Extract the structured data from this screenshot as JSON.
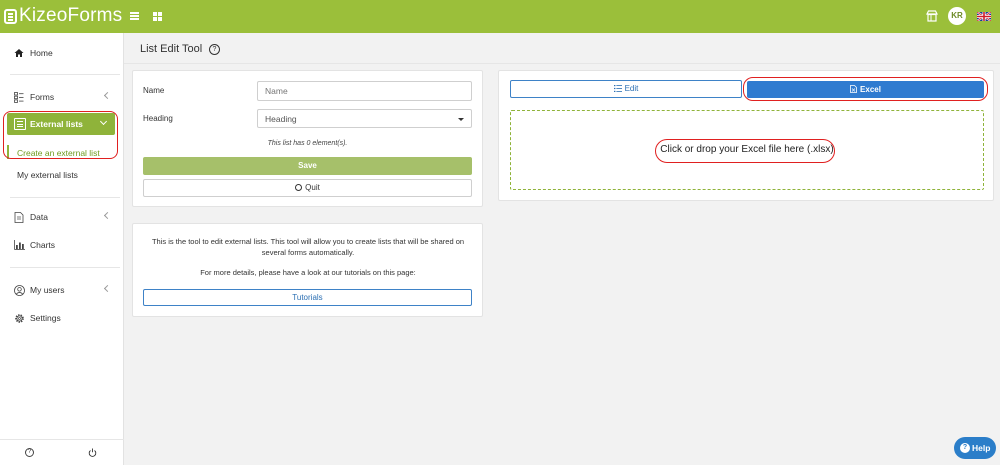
{
  "app": {
    "logo_text": "KizeoForms",
    "avatar_initials": "KR"
  },
  "sidebar": {
    "items": [
      {
        "label": "Home",
        "icon": "home-icon"
      },
      {
        "label": "Forms",
        "icon": "forms-icon"
      },
      {
        "label": "External lists",
        "icon": "list-icon"
      },
      {
        "label": "Data",
        "icon": "data-icon"
      },
      {
        "label": "Charts",
        "icon": "chart-icon"
      },
      {
        "label": "My users",
        "icon": "user-icon"
      },
      {
        "label": "Settings",
        "icon": "gear-icon"
      }
    ],
    "subitems": [
      {
        "label": "Create an external list"
      },
      {
        "label": "My external lists"
      }
    ],
    "footer": {
      "help_icon": "question-circle-icon",
      "power_icon": "power-icon"
    }
  },
  "page": {
    "title": "List Edit Tool"
  },
  "form": {
    "name_label": "Name",
    "name_placeholder": "Name",
    "heading_label": "Heading",
    "heading_value": "Heading",
    "count_text": "This list has 0 element(s).",
    "save_label": "Save",
    "quit_label": "Quit"
  },
  "info": {
    "line1": "This is the tool to edit external lists. This tool will allow you to create lists that will be shared on",
    "line2": "several forms automatically.",
    "line3": "For more details, please have a look at our tutorials on this page:",
    "tutorials_label": "Tutorials"
  },
  "editor": {
    "tab_edit": "Edit",
    "tab_excel": "Excel",
    "drop_text": "Click or drop your Excel file here (.xlsx)"
  },
  "help": {
    "label": "Help"
  },
  "colors": {
    "brand": "#9bbf3a",
    "active": "#8fb33a",
    "primary": "#2f7bd0",
    "annotation": "#e02020"
  }
}
